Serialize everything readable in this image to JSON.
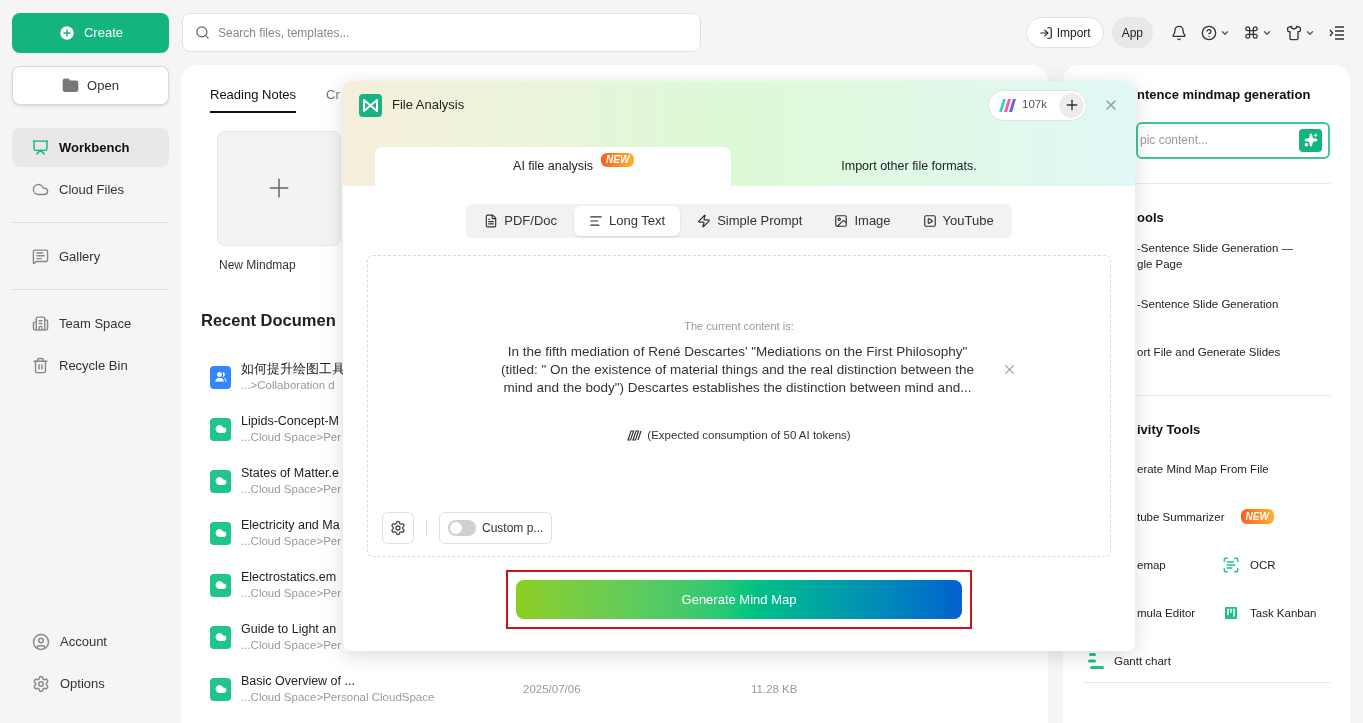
{
  "sidebar": {
    "create_label": "Create",
    "open_label": "Open",
    "nav_groups": [
      [
        {
          "label": "Workbench",
          "selected": true
        },
        {
          "label": "Cloud Files",
          "selected": false
        }
      ],
      [
        {
          "label": "Gallery",
          "selected": false
        }
      ],
      [
        {
          "label": "Team Space",
          "selected": false
        },
        {
          "label": "Recycle Bin",
          "selected": false
        }
      ]
    ],
    "footer": [
      "Account",
      "Options"
    ]
  },
  "topbar": {
    "search_placeholder": "Search files, templates...",
    "import_label": "Import",
    "app_label": "App"
  },
  "main": {
    "tabs": [
      {
        "label": "Reading Notes",
        "selected": true
      },
      {
        "label": "Cr",
        "selected": false
      }
    ],
    "new_tile_label": "New Mindmap",
    "recent_heading": "Recent Documen",
    "documents": [
      {
        "kind": "team",
        "title": "如何提升绘图工具",
        "path": "...>Collaboration d"
      },
      {
        "kind": "cloud",
        "title": "Lipids-Concept-M",
        "path": "...Cloud Space>Per"
      },
      {
        "kind": "cloud",
        "title": "States of Matter.e",
        "path": "...Cloud Space>Per"
      },
      {
        "kind": "cloud",
        "title": "Electricity and Ma",
        "path": "...Cloud Space>Per"
      },
      {
        "kind": "cloud",
        "title": "Electrostatics.em",
        "path": "...Cloud Space>Per"
      },
      {
        "kind": "cloud",
        "title": "Guide to Light an",
        "path": "...Cloud Space>Per"
      },
      {
        "kind": "cloud",
        "title": "Basic Overview of ...",
        "path": "...Cloud Space>Personal CloudSpace",
        "date": "2025/07/06",
        "size": "11.28 KB"
      }
    ]
  },
  "right_panel": {
    "heading": "ntence mindmap generation",
    "input_placeholder": "pic content...",
    "sections": [
      {
        "title": "ools",
        "rows": [
          [
            {
              "kind": "covered",
              "lines": [
                "-Sentence Slide Generation —",
                "gle Page"
              ]
            }
          ],
          [
            {
              "kind": "covered",
              "lines": [
                "-Sentence Slide Generation"
              ]
            }
          ],
          [
            {
              "kind": "covered",
              "lines": [
                "ort File and Generate Slides"
              ]
            }
          ]
        ]
      },
      {
        "title": "ivity Tools",
        "rows": [
          [
            {
              "kind": "covered",
              "lines": [
                "erate Mind Map From File"
              ]
            }
          ],
          [
            {
              "kind": "covered",
              "lines": [
                "tube Summarizer"
              ],
              "badge": "NEW"
            }
          ],
          [
            {
              "kind": "covered",
              "lines": [
                "emap"
              ]
            },
            {
              "kind": "ocr",
              "lines": [
                "OCR"
              ]
            }
          ],
          [
            {
              "kind": "covered",
              "lines": [
                "mula Editor"
              ]
            },
            {
              "kind": "kanban",
              "lines": [
                "Task Kanban"
              ]
            }
          ],
          [
            {
              "kind": "gantt",
              "lines": [
                "Gantt chart"
              ]
            }
          ]
        ]
      }
    ]
  },
  "dialog": {
    "title": "File Analysis",
    "credits": "107k",
    "tabs": [
      {
        "label": "AI file analysis",
        "badge": "NEW",
        "selected": true
      },
      {
        "label": "Import other file formats.",
        "selected": false
      }
    ],
    "sources": [
      {
        "label": "PDF/Doc",
        "selected": false
      },
      {
        "label": "Long Text",
        "selected": true
      },
      {
        "label": "Simple Prompt",
        "selected": false
      },
      {
        "label": "Image",
        "selected": false
      },
      {
        "label": "YouTube",
        "selected": false
      }
    ],
    "content_caption": "The current content is:",
    "content_text": "In the fifth mediation of René Descartes' \"Mediations on the First Philosophy\" (titled: \" On the existence of material things and the real distinction between the mind and the body\") Descartes establishes the distinction between mind and...",
    "token_note": "(Expected consumption of 50 AI tokens)",
    "custom_prompt": {
      "label": "Custom p...",
      "on": false
    },
    "generate_label": "Generate Mind Map",
    "highlighted": true
  }
}
